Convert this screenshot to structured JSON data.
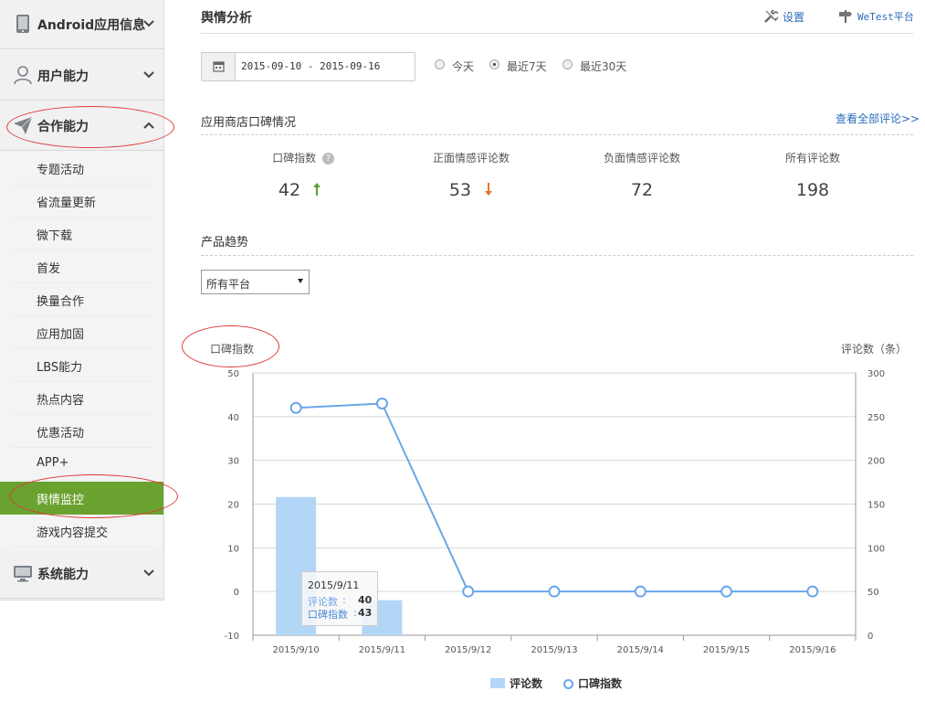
{
  "sidebar": {
    "sections": [
      {
        "label": "Android应用信息",
        "icon": "phone-icon",
        "chevron": "down"
      },
      {
        "label": "用户能力",
        "icon": "user-icon",
        "chevron": "down"
      },
      {
        "label": "合作能力",
        "icon": "paper-plane-icon",
        "chevron": "up"
      },
      {
        "label": "系统能力",
        "icon": "monitor-icon",
        "chevron": "down"
      }
    ],
    "items": [
      "专题活动",
      "省流量更新",
      "微下载",
      "首发",
      "换量合作",
      "应用加固",
      "LBS能力",
      "热点内容",
      "优惠活动",
      "APP+",
      "舆情监控",
      "游戏内容提交"
    ],
    "active_item": "舆情监控",
    "accent_color": "#6aa22f"
  },
  "header": {
    "title": "舆情分析",
    "settings_label": "设置",
    "wetest_label": "WeTest平台"
  },
  "filters": {
    "date_range": "2015-09-10 - 2015-09-16",
    "radios": [
      {
        "label": "今天",
        "checked": false
      },
      {
        "label": "最近7天",
        "checked": true
      },
      {
        "label": "最近30天",
        "checked": false
      }
    ]
  },
  "reputation": {
    "title": "应用商店口碑情况",
    "view_all": "查看全部评论>>",
    "stats": [
      {
        "label": "口碑指数",
        "value": "42",
        "trend": "up",
        "help": "?"
      },
      {
        "label": "正面情感评论数",
        "value": "53",
        "trend": "down"
      },
      {
        "label": "负面情感评论数",
        "value": "72"
      },
      {
        "label": "所有评论数",
        "value": "198"
      }
    ]
  },
  "trend": {
    "title": "产品趋势",
    "platform_select": "所有平台"
  },
  "chart_data": {
    "type": "bar+line",
    "categories": [
      "2015/9/10",
      "2015/9/11",
      "2015/9/12",
      "2015/9/13",
      "2015/9/14",
      "2015/9/15",
      "2015/9/16"
    ],
    "left_axis_label": "口碑指数",
    "right_axis_label": "评论数（条）",
    "left_ticks": [
      50,
      40,
      30,
      20,
      10,
      0,
      -10
    ],
    "right_ticks": [
      300,
      250,
      200,
      150,
      100,
      50,
      0
    ],
    "left_range": [
      -10,
      50
    ],
    "right_range": [
      0,
      300
    ],
    "series": [
      {
        "name": "评论数",
        "type": "bar",
        "axis": "right",
        "color": "#b3d6f7",
        "values": [
          158,
          40,
          0,
          0,
          0,
          0,
          0
        ]
      },
      {
        "name": "口碑指数",
        "type": "line",
        "axis": "left",
        "color": "#6aa6e8",
        "values": [
          42,
          43,
          0,
          0,
          0,
          0,
          0
        ]
      }
    ],
    "tooltip": {
      "date": "2015/9/11",
      "rows": [
        {
          "name": "评论数",
          "value": "40"
        },
        {
          "name": "口碑指数",
          "value": "43"
        }
      ]
    },
    "legend_position": "bottom-center"
  }
}
